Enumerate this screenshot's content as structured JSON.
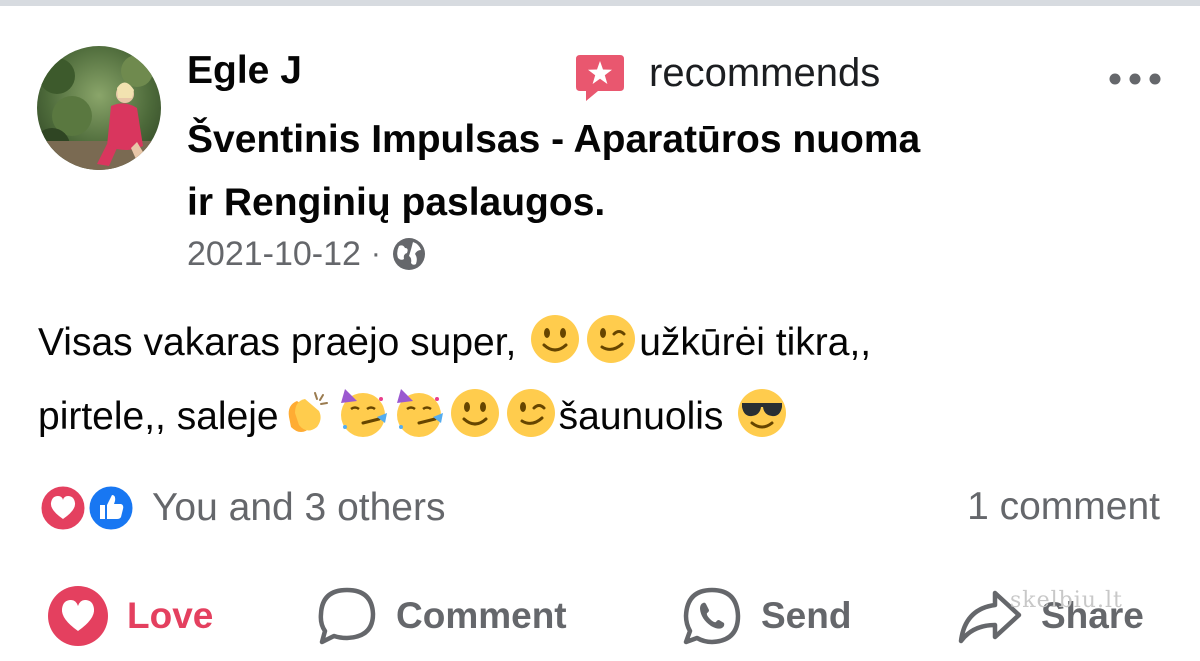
{
  "post": {
    "author": "Egle J",
    "action_text": "recommends",
    "page_name_line1": "Šventinis Impulsas - Aparatūros nuoma",
    "page_name_line2": "ir Renginių paslaugos.",
    "date": "2021-10-12",
    "separator": "·",
    "text_part1": "Visas vakaras praėjo super, ",
    "text_part2": "užkūrėi tikra,,",
    "text_part3": "pirtele,, saleje",
    "text_part4": "šaunuolis ",
    "emojis": [
      "slightly-smiling-face",
      "winking-face",
      "clapping-hands",
      "partying-face",
      "partying-face",
      "slightly-smiling-face",
      "winking-face",
      "smiling-face-with-sunglasses"
    ]
  },
  "engagement": {
    "reactions_text": "You and 3 others",
    "comments_text": "1 comment",
    "reaction_icons": [
      "love-reaction-icon",
      "like-reaction-icon"
    ]
  },
  "actions": {
    "love_label": "Love",
    "comment_label": "Comment",
    "send_label": "Send",
    "share_label": "Share"
  },
  "watermark": "skelbiu.lt",
  "colors": {
    "love": "#e4405f",
    "like": "#1877f2",
    "recommend": "#e9576f",
    "text": "#050505",
    "secondary": "#65676b"
  }
}
